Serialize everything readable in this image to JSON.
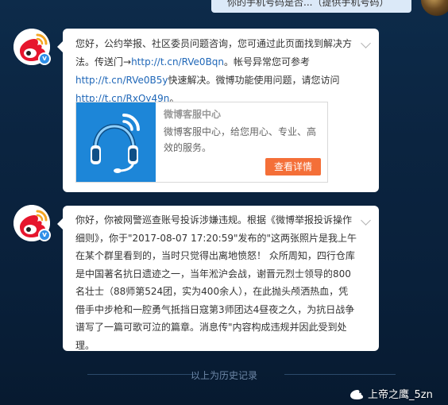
{
  "top_bubble": {
    "text": "你的手机号码是否...（提供手机号码）"
  },
  "messages": [
    {
      "sender": "weibo-customer-service",
      "text_before": "您好，公约举报、社区委员问题咨询，您可通过此页面找到解决方法。传送门→",
      "link1": "http://t.cn/RVe0Bqn",
      "text_mid1": "。帐号异常您可参考",
      "link2": "http://t.cn/RVe0B5y",
      "text_mid2": "快速解决。微博功能使用问题，请您访问",
      "link3": "http://t.cn/RxQy49n",
      "text_end": "。",
      "card": {
        "title": "微博客服中心",
        "desc": "微博客服中心，给您用心、专业、高效的服务。",
        "button": "查看详情"
      }
    },
    {
      "sender": "weibo-police",
      "text": "你好，你被网警巡查账号投诉涉嫌违规。根据《微博举报投诉操作细则》，你于\"2017-08-07 17:20:59\"发布的\"这两张照片是我上午在某个群里看到的，当时只觉得出离地愤怒！ 众所周知，四行仓库是中国著名抗日遗迹之一，当年淞沪会战，谢晋元烈士领导的800名壮士（88师第524团，实为400余人），在此抛头颅洒热血，凭借手中步枪和一腔勇气抵挡日寇第3师团达4昼夜之久，为抗日战争谱写了一篇可歌可泣的篇章。消息传\"内容构成违规并因此受到处理。"
    }
  ],
  "history_label": "以上为历史记录",
  "watermark": "上帝之鹰_5zn",
  "colors": {
    "background": "#0b2440",
    "bubble": "#ffffff",
    "link": "#1f67b8",
    "button": "#f46f38",
    "verified": "#2f8fe8"
  }
}
